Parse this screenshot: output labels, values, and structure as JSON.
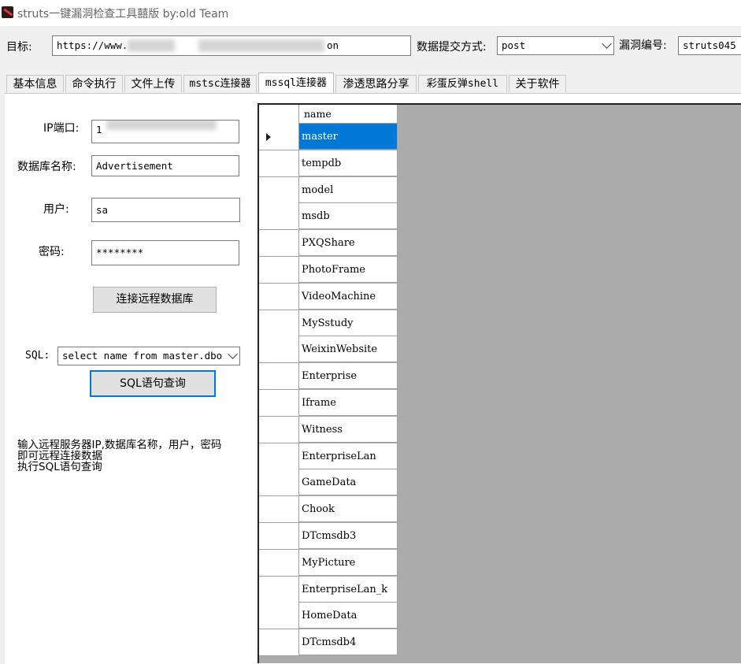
{
  "window": {
    "title": "struts一键漏洞检查工具囍版 by:old Team"
  },
  "toolbar": {
    "target_label": "目标:",
    "target_value_start": "https://www.",
    "target_value_end": "on",
    "method_label": "数据提交方式:",
    "method_value": "post",
    "vuln_label": "漏洞编号:",
    "vuln_value": "struts045"
  },
  "tabs": [
    "基本信息",
    "命令执行",
    "文件上传",
    "mstsc连接器",
    "mssql连接器",
    "渗透思路分享",
    "彩蛋反弹shell",
    "关于软件"
  ],
  "form": {
    "ip_label": "IP端口:",
    "ip_value": "1",
    "db_label": "数据库名称:",
    "db_value": "Advertisement",
    "user_label": "用户:",
    "user_value": "sa",
    "pwd_label": "密码:",
    "pwd_value": "********",
    "connect_button": "连接远程数据库",
    "sql_label": "SQL:",
    "sql_value": "select name from master.dbo",
    "query_button": "SQL语句查询"
  },
  "help": {
    "line1": "输入远程服务器IP,数据库名称，用户，密码",
    "line2": "即可远程连接数据",
    "line3": "执行SQL语句查询"
  },
  "grid": {
    "column": "name",
    "rows": [
      "master",
      "tempdb",
      "model",
      "msdb",
      "PXQShare",
      "PhotoFrame",
      "VideoMachine",
      "MySstudy",
      "WeixinWebsite",
      "Enterprise",
      "Iframe",
      "Witness",
      "EnterpriseLan",
      "GameData",
      "Chook",
      "DTcmsdb3",
      "MyPicture",
      "EnterpriseLan_k",
      "HomeData",
      "DTcmsdb4"
    ],
    "selected_index": 0
  }
}
